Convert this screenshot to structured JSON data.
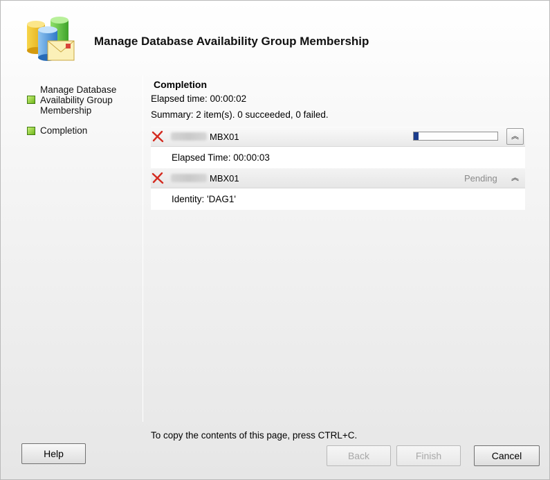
{
  "header": {
    "title": "Manage Database Availability Group Membership",
    "icon": "database-mail-icon"
  },
  "nav": {
    "items": [
      {
        "label": "Manage Database Availability Group Membership",
        "state": "complete"
      },
      {
        "label": "Completion",
        "state": "current"
      }
    ]
  },
  "content": {
    "section_title": "Completion",
    "elapsed": "Elapsed time: 00:00:02",
    "summary": "Summary: 2 item(s). 0 succeeded, 0 failed.",
    "tasks": [
      {
        "name": "MBX01",
        "status_icon": "failed-x-icon",
        "progress_fraction": 0.06,
        "detail": "Elapsed Time: 00:00:03"
      },
      {
        "name": "MBX01",
        "status_icon": "failed-x-icon",
        "status": "Pending",
        "detail": "Identity: 'DAG1'"
      }
    ]
  },
  "footer": {
    "copy_hint": "To copy the contents of this page, press CTRL+C.",
    "help_label": "Help",
    "back_label": "Back",
    "finish_label": "Finish",
    "cancel_label": "Cancel"
  },
  "colors": {
    "progress": "#1b3c8c",
    "bullet": "#6fb51a",
    "fail": "#d42a1f"
  }
}
